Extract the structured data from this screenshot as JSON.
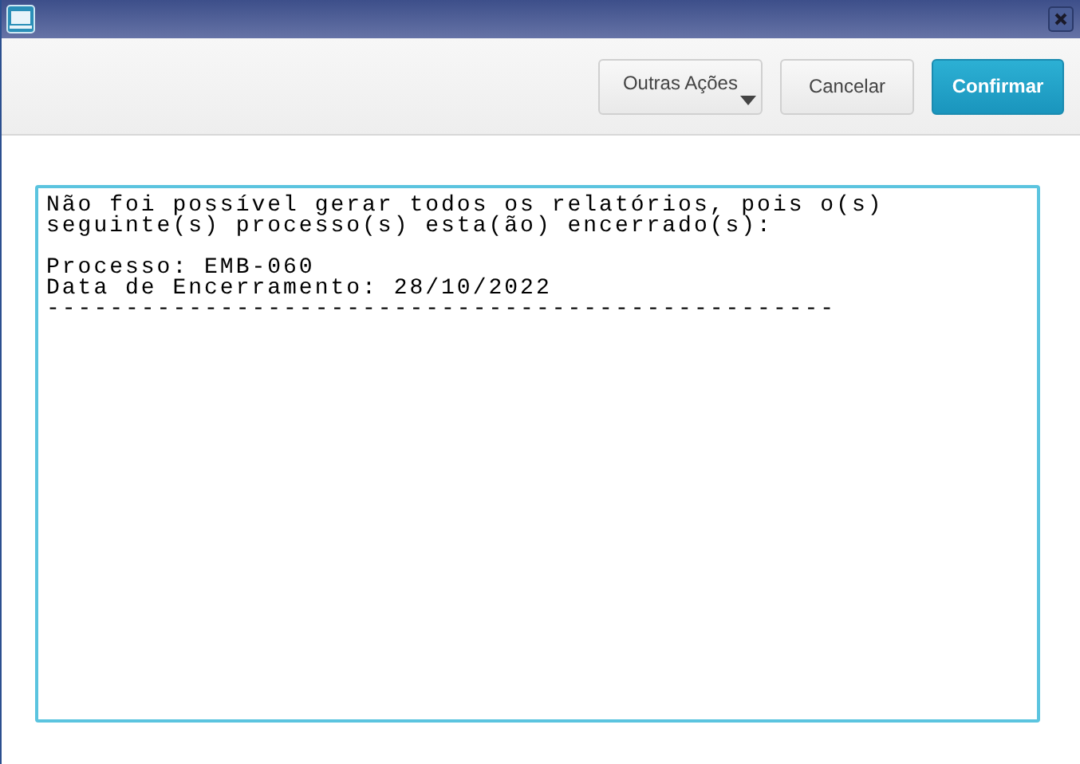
{
  "toolbar": {
    "buttons": [
      {
        "label": "Outras Ações",
        "kind": "menu"
      },
      {
        "label": "Cancelar",
        "kind": "plain"
      },
      {
        "label": "Confirmar",
        "kind": "primary"
      }
    ]
  },
  "message": {
    "paragraphs": [
      [
        "Não foi possível gerar todos os relatórios, pois o(s)",
        "seguinte(s) processo(s) esta(ão) encerrado(s):"
      ],
      [
        "Processo: EMB-060",
        "Data de Encerramento: 28/10/2022",
        "--------------------------------------------------"
      ]
    ]
  }
}
